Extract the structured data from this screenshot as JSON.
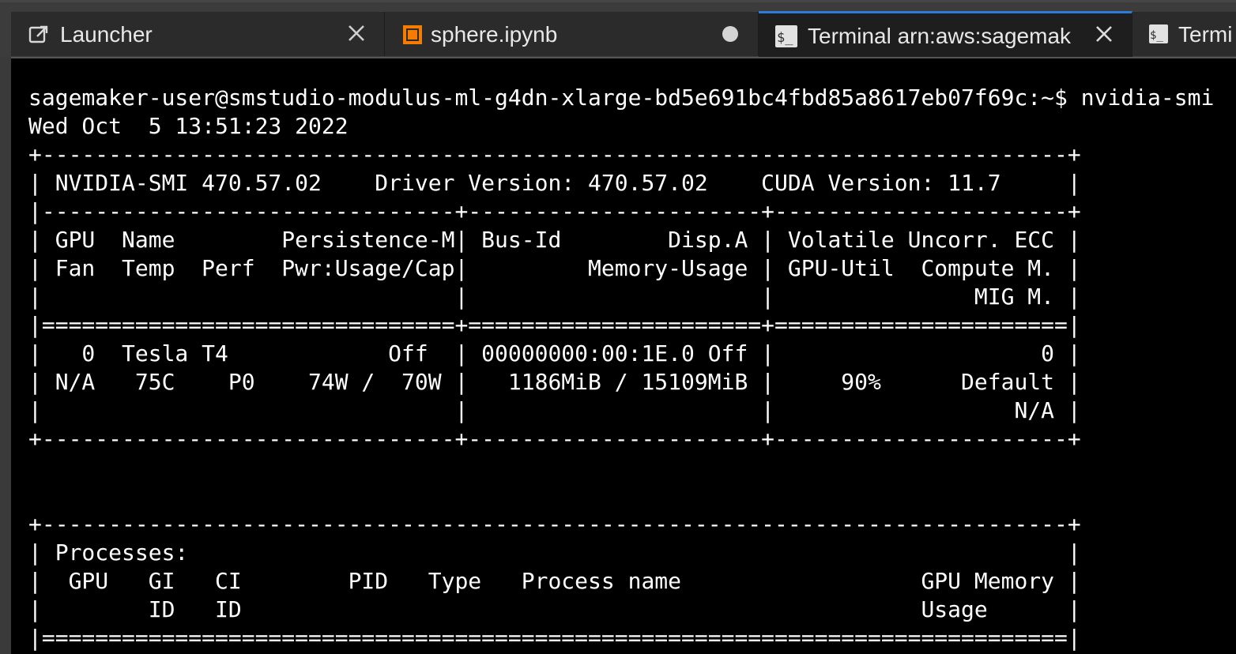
{
  "tabs": [
    {
      "label": "Launcher",
      "icon": "launcher-icon",
      "status": "close"
    },
    {
      "label": "sphere.ipynb",
      "icon": "notebook-icon",
      "status": "modified"
    },
    {
      "label": "Terminal arn:aws:sagemak",
      "icon": "terminal-icon",
      "status": "close",
      "active": true
    },
    {
      "label": "Termi",
      "icon": "terminal-icon",
      "status": "none"
    }
  ],
  "colors": {
    "accent": "#2f7bd8",
    "notebook_orange": "#f57c00",
    "terminal_bg": "#000000",
    "terminal_fg": "#ffffff"
  },
  "terminal": {
    "lines": [
      "sagemaker-user@smstudio-modulus-ml-g4dn-xlarge-bd5e691bc4fbd85a8617eb07f69c:~$ nvidia-smi",
      "Wed Oct  5 13:51:23 2022",
      "+-----------------------------------------------------------------------------+",
      "| NVIDIA-SMI 470.57.02    Driver Version: 470.57.02    CUDA Version: 11.7     |",
      "|-------------------------------+----------------------+----------------------+",
      "| GPU  Name        Persistence-M| Bus-Id        Disp.A | Volatile Uncorr. ECC |",
      "| Fan  Temp  Perf  Pwr:Usage/Cap|         Memory-Usage | GPU-Util  Compute M. |",
      "|                               |                      |               MIG M. |",
      "|===============================+======================+======================|",
      "|   0  Tesla T4            Off  | 00000000:00:1E.0 Off |                    0 |",
      "| N/A   75C    P0    74W /  70W |   1186MiB / 15109MiB |     90%      Default |",
      "|                               |                      |                  N/A |",
      "+-------------------------------+----------------------+----------------------+",
      "",
      "",
      "+-----------------------------------------------------------------------------+",
      "| Processes:                                                                  |",
      "|  GPU   GI   CI        PID   Type   Process name                  GPU Memory |",
      "|        ID   ID                                                   Usage      |",
      "|=============================================================================|",
      "+-----------------------------------------------------------------------------+"
    ]
  }
}
